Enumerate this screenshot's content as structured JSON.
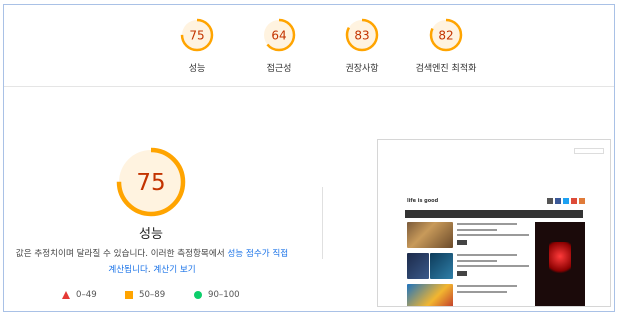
{
  "top_scores": [
    {
      "value": "75",
      "label": "성능",
      "fraction": 0.75,
      "color": "#ffa400",
      "text_color": "#c33300"
    },
    {
      "value": "64",
      "label": "접근성",
      "fraction": 0.64,
      "color": "#ffa400",
      "text_color": "#c33300"
    },
    {
      "value": "83",
      "label": "권장사항",
      "fraction": 0.83,
      "color": "#ffa400",
      "text_color": "#c33300"
    },
    {
      "value": "82",
      "label": "검색엔진 최적화",
      "fraction": 0.82,
      "color": "#ffa400",
      "text_color": "#c33300"
    }
  ],
  "main_score": {
    "value": "75",
    "label": "성능",
    "fraction": 0.75,
    "color": "#ffa400",
    "text_color": "#c33300"
  },
  "description": {
    "text": "값은 추정치이며 달라질 수 있습니다. 이러한 측정항목에서 ",
    "link1": "성능 점수가 직접 계산됩니다",
    "text2": ". ",
    "link2": "계산기 보기"
  },
  "legend": [
    {
      "icon": "red-triangle-icon",
      "range": "0–49",
      "color": "#e53935"
    },
    {
      "icon": "orange-square-icon",
      "range": "50–89",
      "color": "#ffa400"
    },
    {
      "icon": "green-circle-icon",
      "range": "90–100",
      "color": "#0cce6b"
    }
  ],
  "thumbnail": {
    "site_title": "life is good"
  }
}
